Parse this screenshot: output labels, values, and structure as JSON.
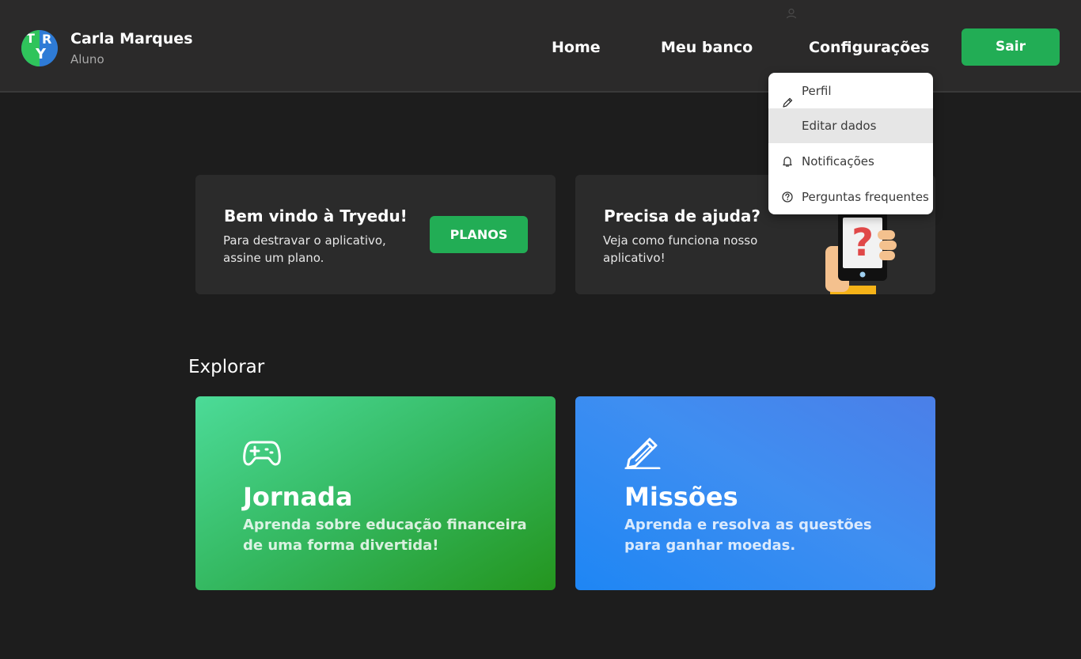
{
  "header": {
    "logo_letters": [
      "T",
      "R",
      "Y"
    ],
    "user_name": "Carla Marques",
    "user_role": "Aluno",
    "nav": {
      "home": "Home",
      "bank": "Meu banco",
      "config": "Configurações"
    },
    "logout_label": "Sair"
  },
  "dropdown": {
    "items": [
      {
        "label": "Perfil",
        "icon": "pencil-icon"
      },
      {
        "label": "Editar dados",
        "icon": ""
      },
      {
        "label": "Notificações",
        "icon": "bell-icon"
      },
      {
        "label": "Perguntas frequentes",
        "icon": "question-circle-icon"
      }
    ],
    "highlighted_index": 1
  },
  "cards": {
    "welcome": {
      "title": "Bem vindo à Tryedu!",
      "text": "Para destravar o aplicativo, assine um plano.",
      "button": "PLANOS"
    },
    "help": {
      "title": "Precisa de ajuda?",
      "text": "Veja como funciona nosso aplicativo!",
      "illustration": "phone-question-icon"
    }
  },
  "explore": {
    "title": "Explorar",
    "items": [
      {
        "title": "Jornada",
        "text": "Aprenda sobre educação financeira de uma forma divertida!",
        "icon": "gamepad-icon"
      },
      {
        "title": "Missões",
        "text": "Aprenda e resolva as questões para ganhar moedas.",
        "icon": "edit-pencil-icon"
      }
    ]
  },
  "colors": {
    "background": "#1d1d1d",
    "header": "#2b2a2a",
    "card": "#2b2b2b",
    "accent_green": "#22ad55",
    "accent_blue": "#2e7bd6"
  }
}
